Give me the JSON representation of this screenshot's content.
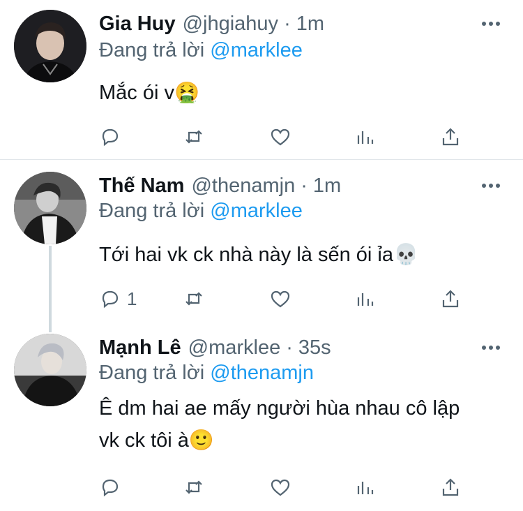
{
  "reply_prefix": "Đang trả lời",
  "tweets": [
    {
      "name": "Gia Huy",
      "handle": "@jhgiahuy",
      "time": "1m",
      "reply_to": "@marklee",
      "text_lines": [
        "Mắc ói v🤮"
      ],
      "reply_count": "",
      "avatar": "avatar-gia-huy"
    },
    {
      "name": "Thế Nam",
      "handle": "@thenamjn",
      "time": "1m",
      "reply_to": "@marklee",
      "text_lines": [
        "Tới hai vk ck nhà này là sến ói ỉa💀"
      ],
      "reply_count": "1",
      "avatar": "avatar-the-nam"
    },
    {
      "name": "Mạnh Lê",
      "handle": "@marklee",
      "time": "35s",
      "reply_to": "@thenamjn",
      "text_lines": [
        "Ê dm hai ae mấy người hùa nhau cô lập",
        "vk ck tôi à🙂"
      ],
      "reply_count": "",
      "avatar": "avatar-manh-le"
    }
  ],
  "separator": "·",
  "colors": {
    "accent": "#1d9bf0",
    "secondary_text": "#536471",
    "primary_text": "#0f1419",
    "divider": "#e1e6ea"
  },
  "icons": [
    "reply-icon",
    "retweet-icon",
    "like-icon",
    "analytics-icon",
    "share-icon",
    "more-icon"
  ]
}
